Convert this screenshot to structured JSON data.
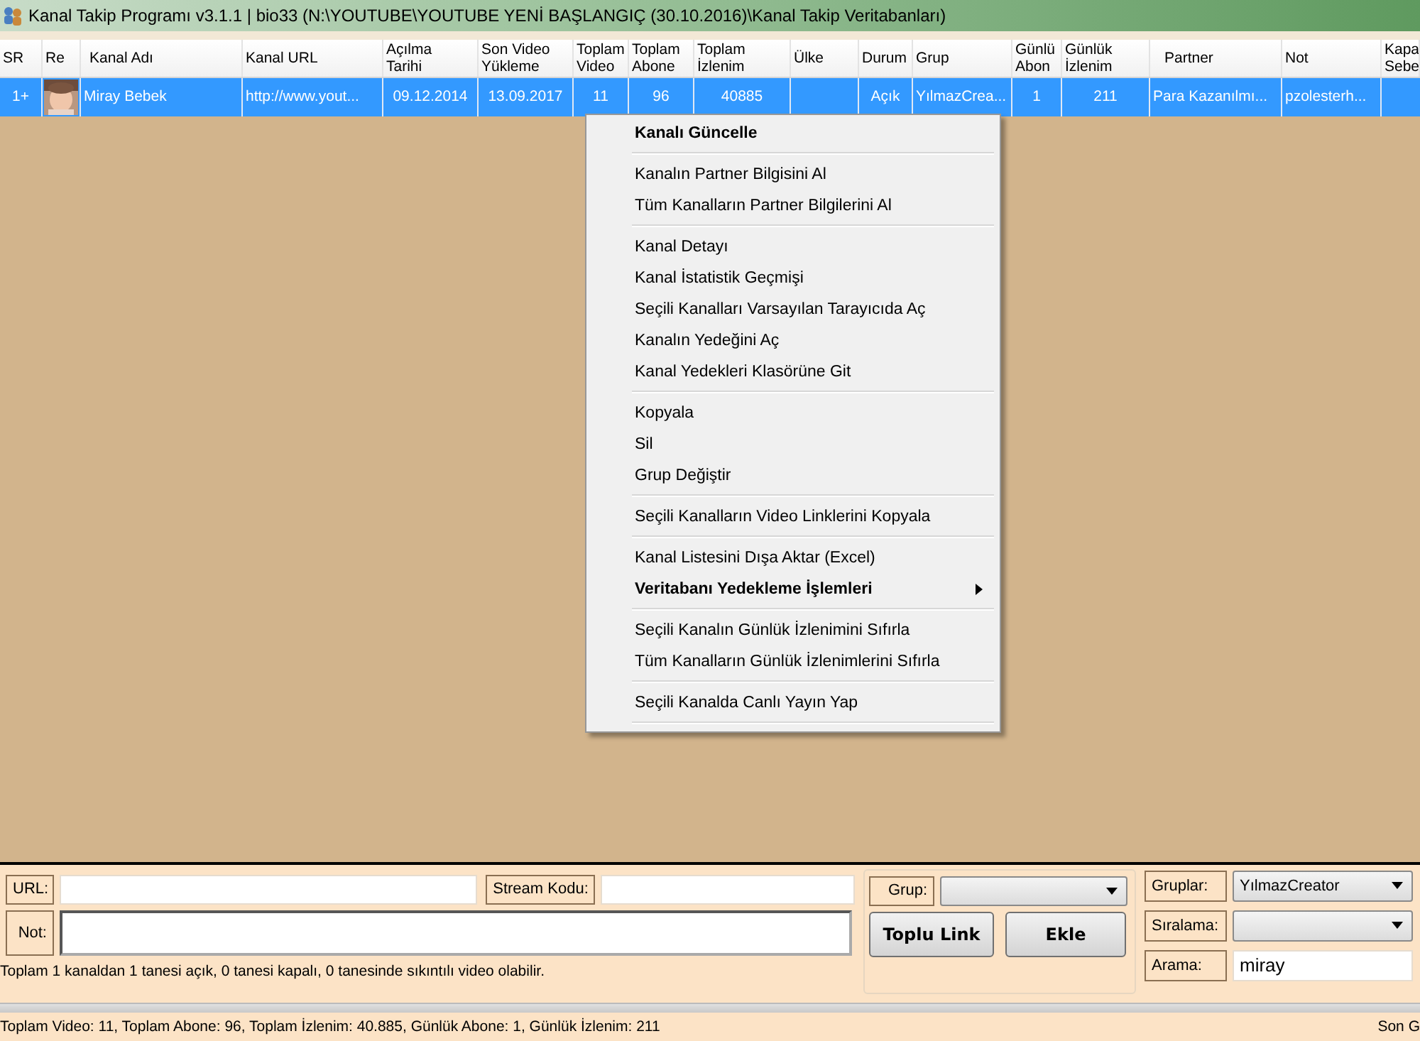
{
  "window": {
    "title": "Kanal Takip Programı v3.1.1 | bio33 (N:\\YOUTUBE\\YOUTUBE YENİ BAŞLANGIÇ (30.10.2016)\\Kanal Takip Veritabanları)"
  },
  "table": {
    "columns": [
      {
        "label": "SR"
      },
      {
        "label": "Re"
      },
      {
        "label": "Kanal Adı"
      },
      {
        "label": "Kanal URL"
      },
      {
        "label": "Açılma\nTarihi"
      },
      {
        "label": "Son Video\nYükleme"
      },
      {
        "label": "Toplam\nVideo"
      },
      {
        "label": "Toplam\nAbone"
      },
      {
        "label": "Toplam\nİzlenim"
      },
      {
        "label": "Ülke"
      },
      {
        "label": "Durum"
      },
      {
        "label": "Grup"
      },
      {
        "label": "Günlü\nAbon"
      },
      {
        "label": "Günlük\nİzlenim"
      },
      {
        "label": "Partner"
      },
      {
        "label": "Not"
      },
      {
        "label": "Kapa\nSebe"
      }
    ],
    "rows": [
      {
        "selected": true,
        "cells": [
          "1+",
          {
            "kind": "picture"
          },
          "Miray Bebek",
          "http://www.yout...",
          "09.12.2014",
          "13.09.2017",
          "11",
          "96",
          "40885",
          "",
          "Açık",
          "YılmazCrea...",
          "1",
          "211",
          "Para Kazanılmı...",
          "pzolesterh...",
          ""
        ]
      }
    ]
  },
  "context_menu": {
    "items": [
      {
        "kind": "item",
        "label": "Kanalı Güncelle",
        "bold": true
      },
      {
        "kind": "separator"
      },
      {
        "kind": "item",
        "label": "Kanalın Partner Bilgisini Al"
      },
      {
        "kind": "item",
        "label": "Tüm Kanalların Partner Bilgilerini Al"
      },
      {
        "kind": "separator"
      },
      {
        "kind": "item",
        "label": "Kanal Detayı"
      },
      {
        "kind": "item",
        "label": "Kanal İstatistik Geçmişi"
      },
      {
        "kind": "item",
        "label": "Seçili Kanalları Varsayılan Tarayıcıda Aç"
      },
      {
        "kind": "item",
        "label": "Kanalın Yedeğini Aç"
      },
      {
        "kind": "item",
        "label": "Kanal Yedekleri Klasörüne Git"
      },
      {
        "kind": "separator"
      },
      {
        "kind": "item",
        "label": "Kopyala"
      },
      {
        "kind": "item",
        "label": "Sil"
      },
      {
        "kind": "item",
        "label": "Grup Değiştir"
      },
      {
        "kind": "separator"
      },
      {
        "kind": "item",
        "label": "Seçili Kanalların Video Linklerini Kopyala"
      },
      {
        "kind": "separator"
      },
      {
        "kind": "item",
        "label": "Kanal Listesini Dışa Aktar (Excel)"
      },
      {
        "kind": "item",
        "label": "Veritabanı Yedekleme İşlemleri",
        "bold": true,
        "submenu": true
      },
      {
        "kind": "separator"
      },
      {
        "kind": "item",
        "label": "Seçili Kanalın Günlük İzlenimini Sıfırla"
      },
      {
        "kind": "item",
        "label": "Tüm Kanalların Günlük İzlenimlerini Sıfırla"
      },
      {
        "kind": "separator"
      },
      {
        "kind": "item",
        "label": "Seçili Kanalda Canlı Yayın Yap"
      },
      {
        "kind": "separator"
      }
    ]
  },
  "form": {
    "url_label": "URL:",
    "stream_label": "Stream Kodu:",
    "not_label": "Not:",
    "grup_label": "Grup:",
    "toplu_link_button": "Toplu Link",
    "ekle_button": "Ekle",
    "gruplar_label": "Gruplar:",
    "gruplar_value": "YılmazCreator",
    "siralama_label": "Sıralama:",
    "arama_label": "Arama:",
    "arama_value": "miray"
  },
  "summary": "Toplam 1 kanaldan 1 tanesi açık, 0 tanesi kapalı, 0 tanesinde sıkıntılı video olabilir.",
  "status_bar": {
    "left": "Toplam Video: 11, Toplam Abone: 96, Toplam İzlenim: 40.885, Günlük Abone: 1, Günlük İzlenim: 211",
    "right": "Son G"
  }
}
